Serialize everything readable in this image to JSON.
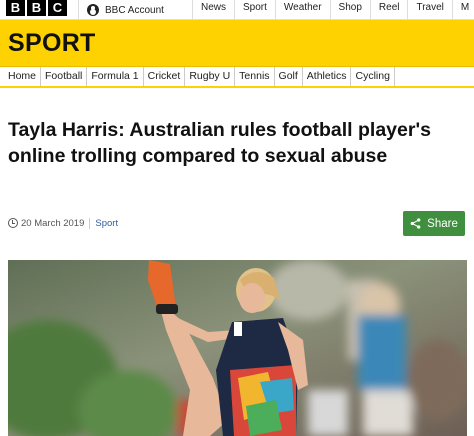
{
  "brand": {
    "letters": [
      "B",
      "B",
      "C"
    ]
  },
  "account": {
    "label": "BBC Account"
  },
  "topnav": [
    "News",
    "Sport",
    "Weather",
    "Shop",
    "Reel",
    "Travel",
    "M"
  ],
  "section": {
    "title": "SPORT"
  },
  "secnav": [
    "Home",
    "Football",
    "Formula 1",
    "Cricket",
    "Rugby U",
    "Tennis",
    "Golf",
    "Athletics",
    "Cycling"
  ],
  "article": {
    "headline": "Tayla Harris: Australian rules football player's online trolling compared to sexual abuse",
    "date": "20 March 2019",
    "category": "Sport",
    "share_label": "Share"
  },
  "colors": {
    "accent": "#fed200",
    "share": "#3f8f3f",
    "link": "#2f5d9c"
  },
  "icons": [
    "person-icon",
    "clock-icon",
    "share-icon"
  ]
}
